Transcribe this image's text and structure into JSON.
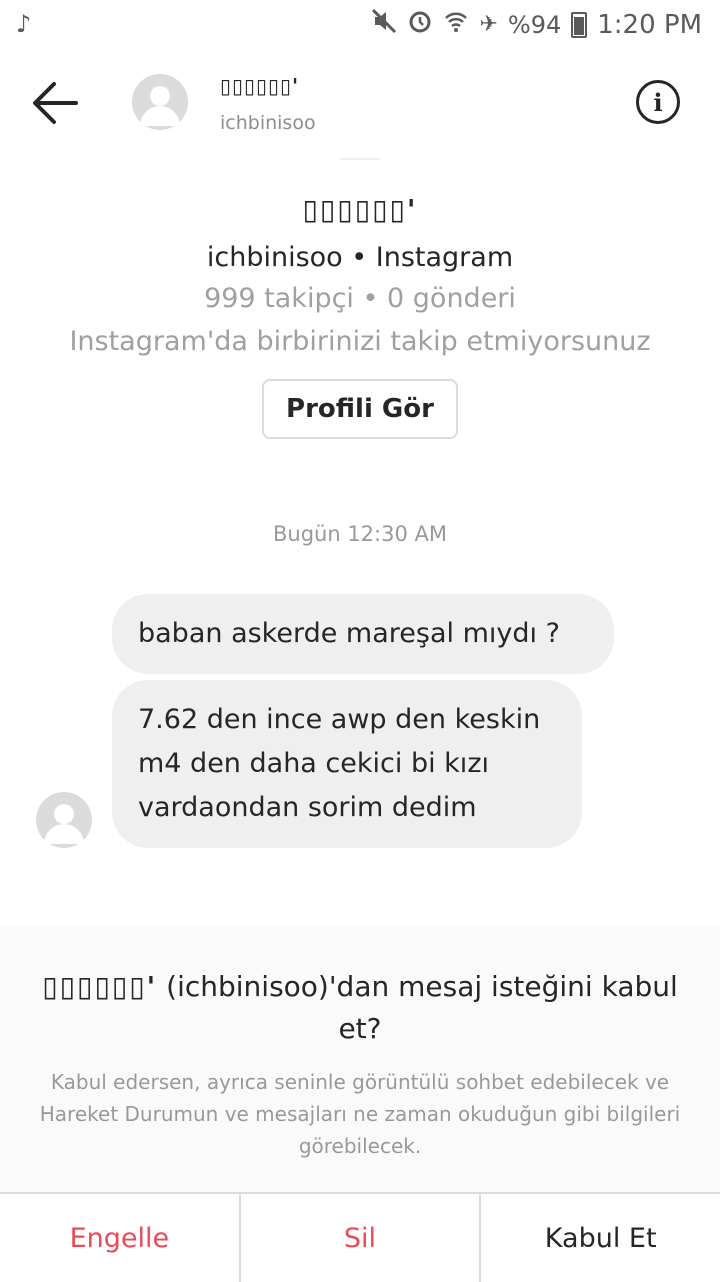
{
  "status_bar": {
    "notification_icon": "music-note-icon",
    "battery_text": "%94",
    "time": "1:20 PM"
  },
  "header": {
    "display_name": "▯▯▯▯▯▯'",
    "username": "ichbinisoo"
  },
  "profile": {
    "display_name": "▯▯▯▯▯▯'",
    "subtitle": "ichbinisoo • Instagram",
    "stats": "999 takipçi • 0 gönderi",
    "follow_status": "Instagram'da birbirinizi takip etmiyorsunuz",
    "view_profile_label": "Profili Gör"
  },
  "thread": {
    "timestamp": "Bugün 12:30 AM",
    "messages": [
      "baban askerde mareşal mıydı ?",
      "7.62 den ince awp den keskin m4 den daha cekici bi kızı vardaondan sorim dedim"
    ]
  },
  "request": {
    "title_name": "▯▯▯▯▯▯'",
    "title_rest": " (ichbinisoo)'dan mesaj isteğini kabul et?",
    "description": "Kabul edersen, ayrıca seninle görüntülü sohbet edebilecek ve Hareket Durumun ve mesajları ne zaman okuduğun gibi bilgileri görebilecek."
  },
  "actions": {
    "block_label": "Engelle",
    "delete_label": "Sil",
    "accept_label": "Kabul Et"
  },
  "colors": {
    "danger": "#ed4956",
    "bubble": "#efefef",
    "muted_text": "#999999"
  }
}
